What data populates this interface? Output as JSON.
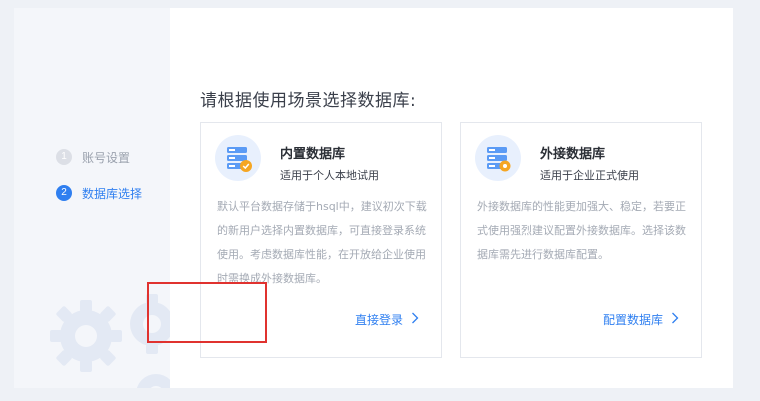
{
  "steps": [
    {
      "num": "1",
      "label": "账号设置"
    },
    {
      "num": "2",
      "label": "数据库选择"
    }
  ],
  "main": {
    "title": "请根据使用场景选择数据库:",
    "cards": [
      {
        "title": "内置数据库",
        "subtitle": "适用于个人本地试用",
        "description": "默认平台数据存储于hsql中，建议初次下载的新用户选择内置数据库，可直接登录系统使用。考虑数据库性能，在开放给企业使用时需换成外接数据库。",
        "action": "直接登录",
        "icon": "database-check-icon"
      },
      {
        "title": "外接数据库",
        "subtitle": "适用于企业正式使用",
        "description": "外接数据库的性能更加强大、稳定，若要正式使用强烈建议配置外接数据库。选择该数据库需先进行数据库配置。",
        "action": "配置数据库",
        "icon": "database-gear-icon"
      }
    ]
  },
  "colors": {
    "accent": "#2f7ff0",
    "highlight": "#e0322f",
    "icon_orange": "#f5a623"
  }
}
